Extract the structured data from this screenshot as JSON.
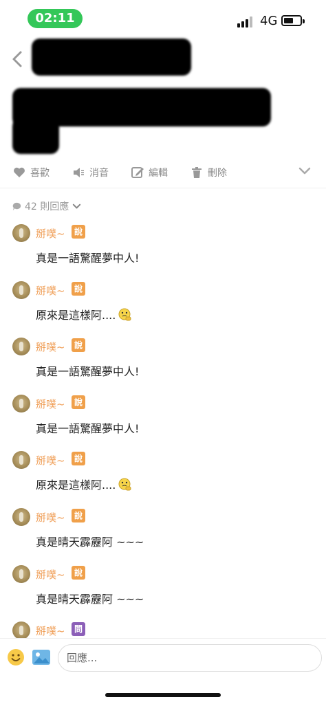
{
  "status_bar": {
    "time": "02:11",
    "network": "4G",
    "battery_level": 0.55
  },
  "post": {
    "title_redacted": true
  },
  "actions": [
    {
      "label": "喜歡",
      "icon": "heart-icon"
    },
    {
      "label": "消音",
      "icon": "mute-icon"
    },
    {
      "label": "編輯",
      "icon": "edit-icon"
    },
    {
      "label": "刪除",
      "icon": "trash-icon"
    }
  ],
  "replies": {
    "count_label": "42 則回應"
  },
  "comments": [
    {
      "user": "掰噗~",
      "badge": "說",
      "text": "真是一語驚醒夢中人!",
      "emoji": false
    },
    {
      "user": "掰噗~",
      "badge": "說",
      "text": "原來是這樣阿....",
      "emoji": true
    },
    {
      "user": "掰噗~",
      "badge": "說",
      "text": "真是一語驚醒夢中人!",
      "emoji": false
    },
    {
      "user": "掰噗~",
      "badge": "說",
      "text": "真是一語驚醒夢中人!",
      "emoji": false
    },
    {
      "user": "掰噗~",
      "badge": "說",
      "text": "原來是這樣阿....",
      "emoji": true
    },
    {
      "user": "掰噗~",
      "badge": "說",
      "text": "真是晴天霹靂阿 ~~~",
      "emoji": false
    },
    {
      "user": "掰噗~",
      "badge": "說",
      "text": "真是晴天霹靂阿 ~~~",
      "emoji": false
    },
    {
      "user": "掰噗~",
      "badge": "問",
      "text": "",
      "emoji": false
    }
  ],
  "input": {
    "placeholder": "回應..."
  },
  "colors": {
    "status_pill": "#34c759",
    "username": "#f0a05a",
    "badge_say": "#f0a04a",
    "badge_ask": "#8c5fb8"
  }
}
